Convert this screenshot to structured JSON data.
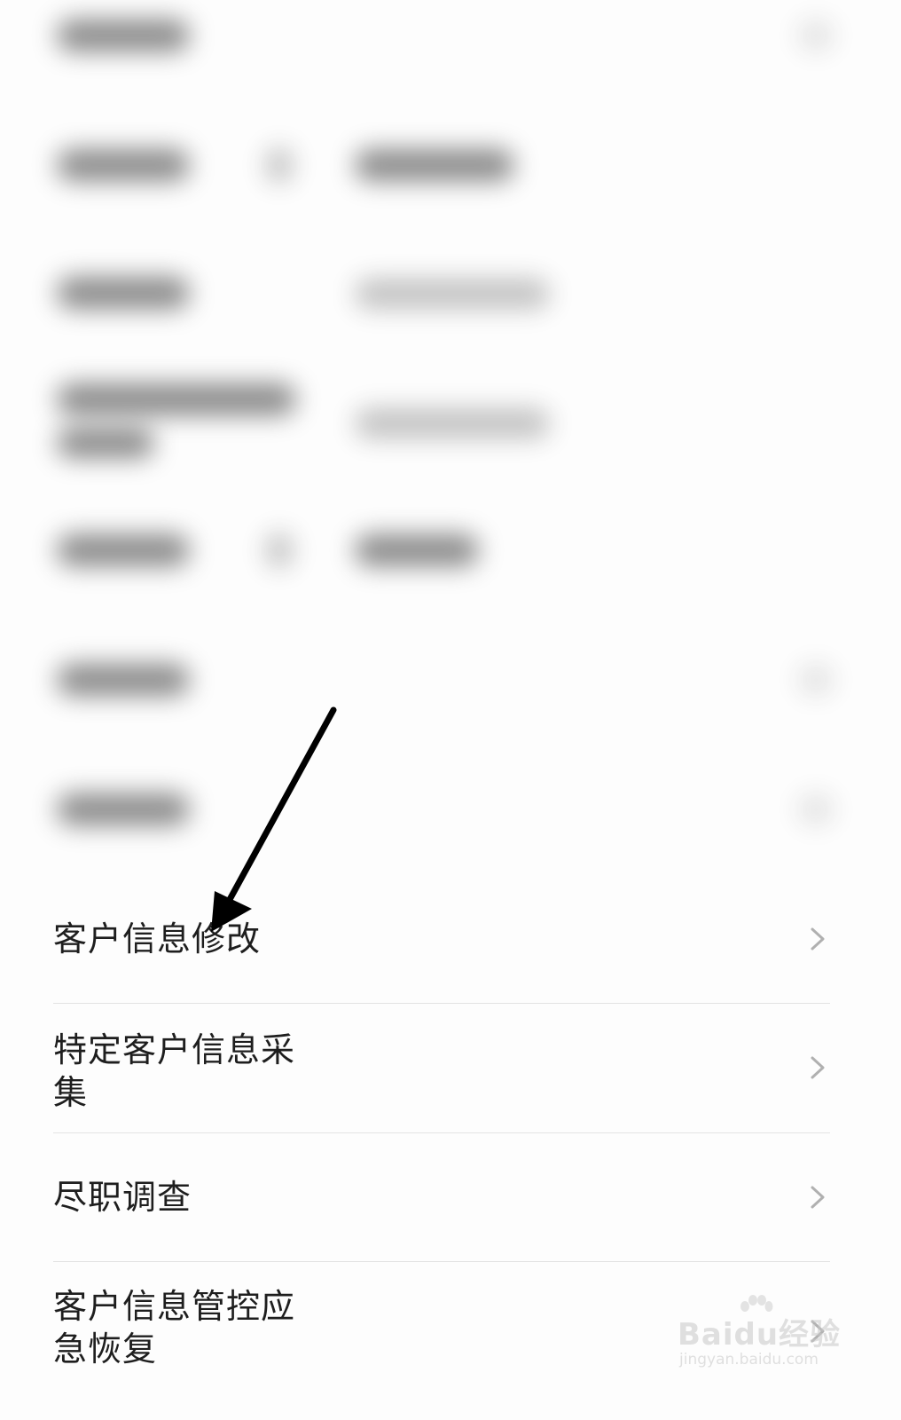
{
  "menu": {
    "items": [
      {
        "label": "客户信息修改"
      },
      {
        "label": "特定客户信息采集"
      },
      {
        "label": "尽职调查"
      },
      {
        "label": "客户信息管控应急恢复"
      }
    ]
  },
  "icons": {
    "chevron": "chevron-right-icon",
    "arrow": "annotation-arrow"
  },
  "watermark": {
    "brand": "Baidu经验",
    "url": "jingyan.baidu.com"
  },
  "colors": {
    "background": "#fdfdfd",
    "text": "#1e1e1e",
    "divider": "#e3e3e3",
    "chevron": "#b0b0b0",
    "arrow": "#000000"
  }
}
